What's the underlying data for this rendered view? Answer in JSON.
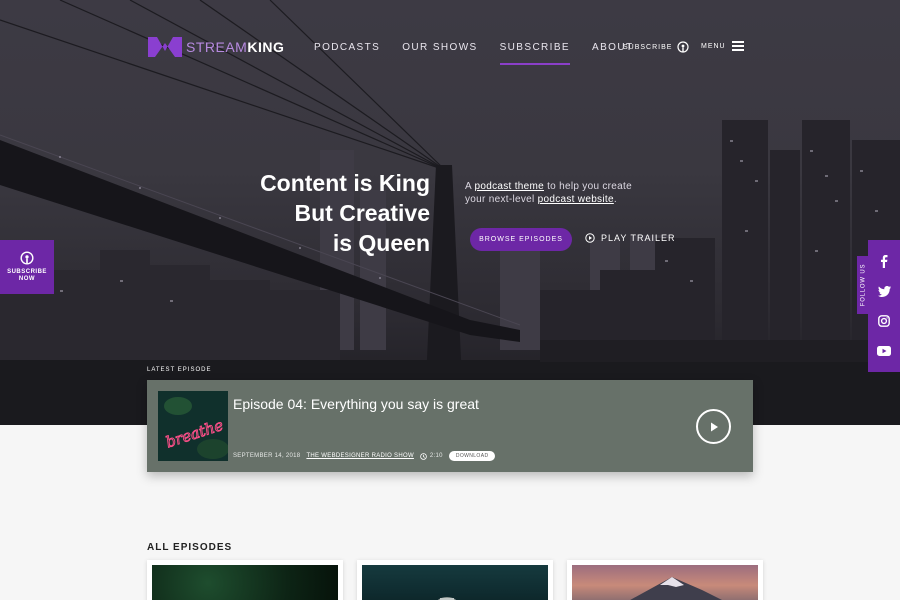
{
  "brand": {
    "name_light": "STREAM",
    "name_bold": "KING",
    "accent": "#6d27a6"
  },
  "nav": {
    "items": [
      {
        "label": "PODCASTS",
        "active": false
      },
      {
        "label": "OUR SHOWS",
        "active": false
      },
      {
        "label": "SUBSCRIBE",
        "active": true
      },
      {
        "label": "ABOUT",
        "active": false
      }
    ],
    "subscribe_label": "SUBSCRIBE",
    "menu_label": "MENU"
  },
  "hero": {
    "headline": [
      "Content is King",
      "But Creative",
      "is Queen"
    ],
    "tagline_pre": "A ",
    "tagline_link1": "podcast theme",
    "tagline_mid": " to help you create your next-level ",
    "tagline_link2": "podcast website",
    "tagline_post": ".",
    "browse_label": "BROWSE EPISODES",
    "trailer_label": "PLAY TRAILER"
  },
  "side": {
    "subscribe_now": [
      "SUBSCRIBE",
      "NOW"
    ],
    "follow_us": "FOLLOW US",
    "social_icons": [
      "facebook-icon",
      "twitter-icon",
      "instagram-icon",
      "youtube-icon"
    ]
  },
  "latest": {
    "label": "LATEST EPISODE",
    "title": "Episode 04: Everything you say is great",
    "date": "SEPTEMBER 14, 2018",
    "show": "THE WEBDESIGNER RADIO SHOW",
    "duration": "2:10",
    "download_label": "DOWNLOAD",
    "thumb_text": "breathe"
  },
  "all_episodes": {
    "title": "ALL EPISODES"
  }
}
